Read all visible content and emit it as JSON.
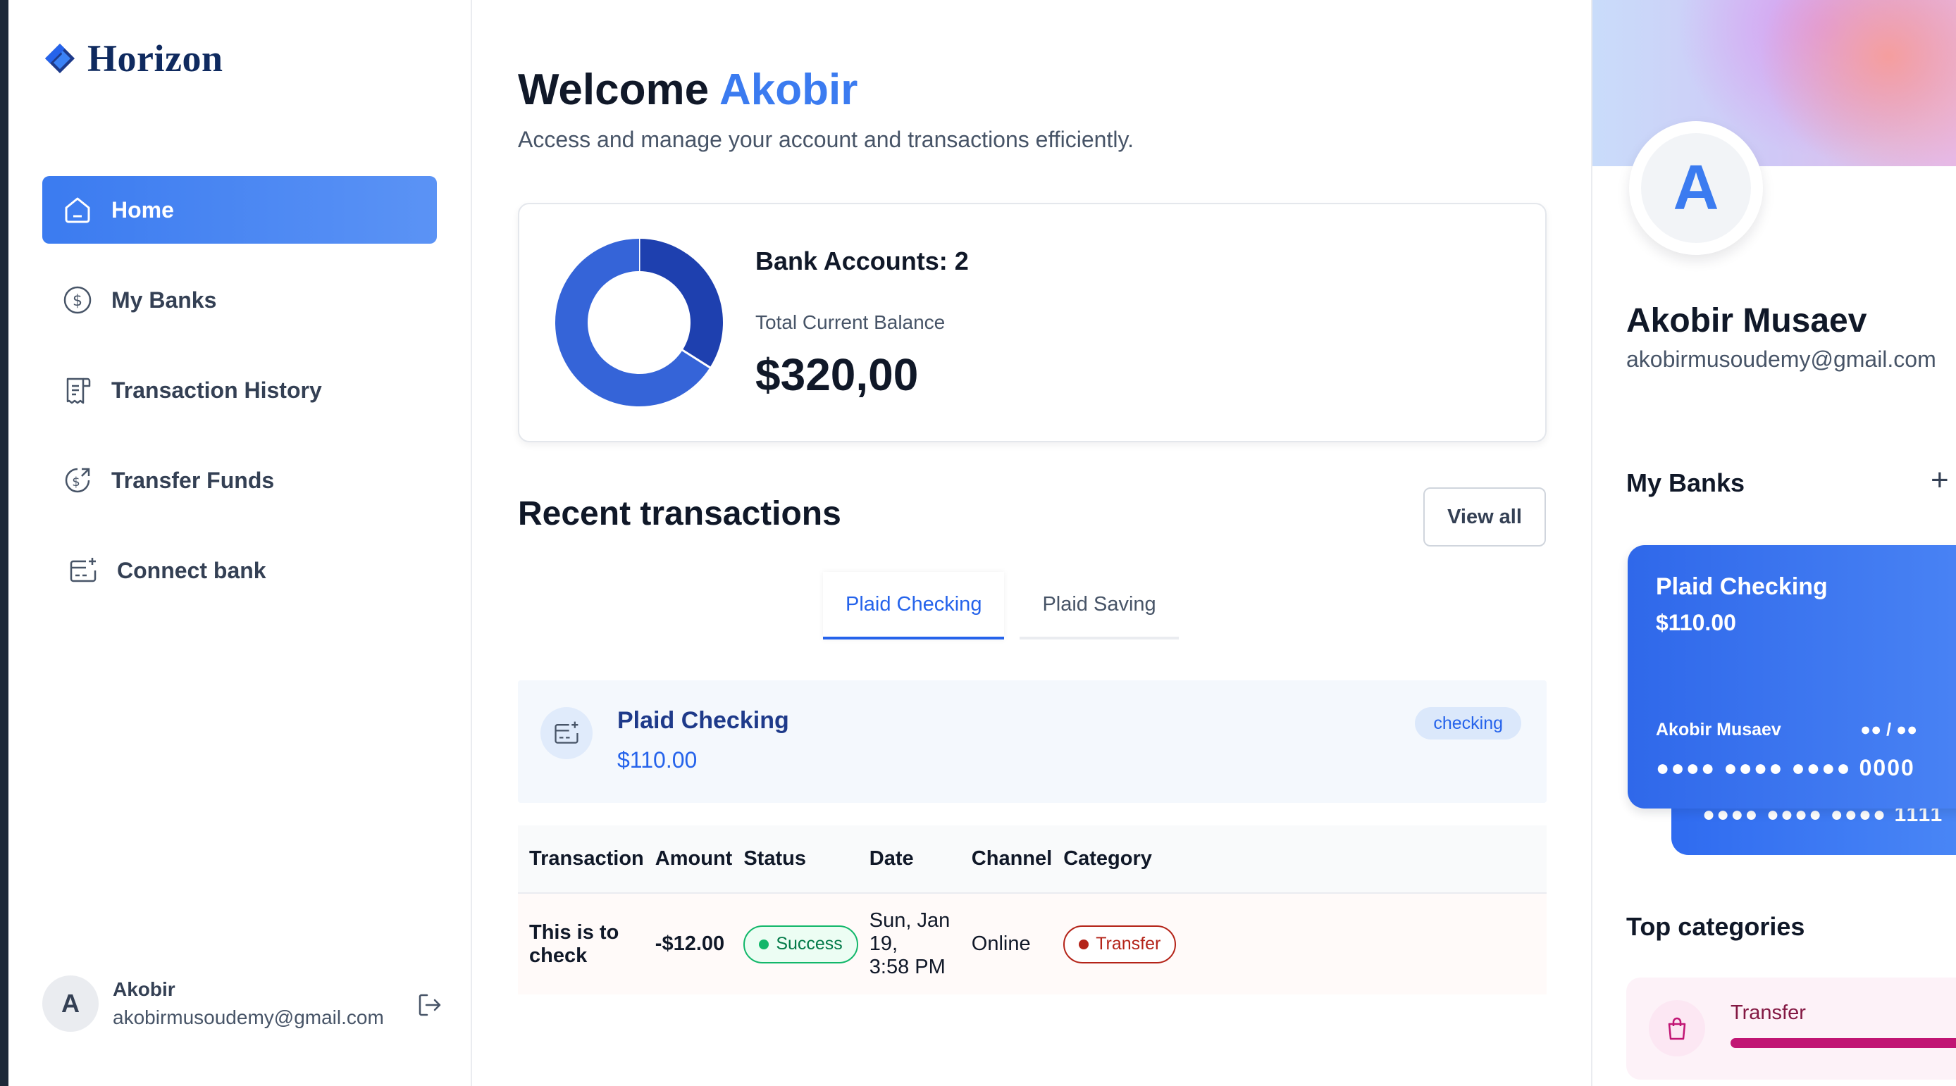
{
  "app": {
    "name": "Horizon"
  },
  "sidebar": {
    "items": [
      {
        "label": "Home",
        "icon": "home-icon",
        "active": true
      },
      {
        "label": "My Banks",
        "icon": "dollar-circle-icon",
        "active": false
      },
      {
        "label": "Transaction History",
        "icon": "receipt-icon",
        "active": false
      },
      {
        "label": "Transfer Funds",
        "icon": "money-send-icon",
        "active": false
      },
      {
        "label": "Connect bank",
        "icon": "card-add-icon",
        "active": false
      }
    ],
    "user": {
      "initial": "A",
      "name": "Akobir",
      "email": "akobirmusoudemy@gmail.com"
    }
  },
  "header": {
    "welcome": "Welcome",
    "user_first_name": "Akobir",
    "subtitle": "Access and manage your account and transactions efficiently."
  },
  "summary": {
    "bank_accounts_label": "Bank Accounts: 2",
    "balance_label": "Total Current Balance",
    "balance_value": "$320,00",
    "donut_shares": [
      0.34,
      0.66
    ],
    "donut_colors": [
      "#1e40af",
      "#3564d8"
    ]
  },
  "recent": {
    "title": "Recent transactions",
    "view_all_label": "View all",
    "tabs": [
      {
        "label": "Plaid Checking",
        "active": true
      },
      {
        "label": "Plaid Saving",
        "active": false
      }
    ],
    "account": {
      "name": "Plaid Checking",
      "balance": "$110.00",
      "badge": "checking"
    },
    "columns": [
      "Transaction",
      "Amount",
      "Status",
      "Date",
      "Channel",
      "Category"
    ],
    "rows": [
      {
        "name": "This is to check",
        "amount": "-$12.00",
        "status": "Success",
        "date_line1": "Sun, Jan 19,",
        "date_line2": "3:58 PM",
        "channel": "Online",
        "category": "Transfer"
      }
    ]
  },
  "profile": {
    "initial": "A",
    "name": "Akobir Musaev",
    "email": "akobirmusoudemy@gmail.com"
  },
  "my_banks": {
    "title": "My Banks",
    "add_label": "+",
    "card": {
      "name": "Plaid Checking",
      "balance": "$110.00",
      "holder": "Akobir Musaev",
      "expiry": "●● / ●●",
      "number": "●●●● ●●●● ●●●● 0000"
    },
    "back_card_number": "●●●● ●●●● ●●●● 1111"
  },
  "top_categories": {
    "title": "Top categories",
    "items": [
      {
        "label": "Transfer",
        "icon": "shopping-bag-icon",
        "color": "#c11574"
      }
    ]
  },
  "colors": {
    "accent": "#3b7bf0",
    "brand_dark": "#0f2a5f",
    "danger": "#e1432f",
    "success": "#12b76a"
  }
}
